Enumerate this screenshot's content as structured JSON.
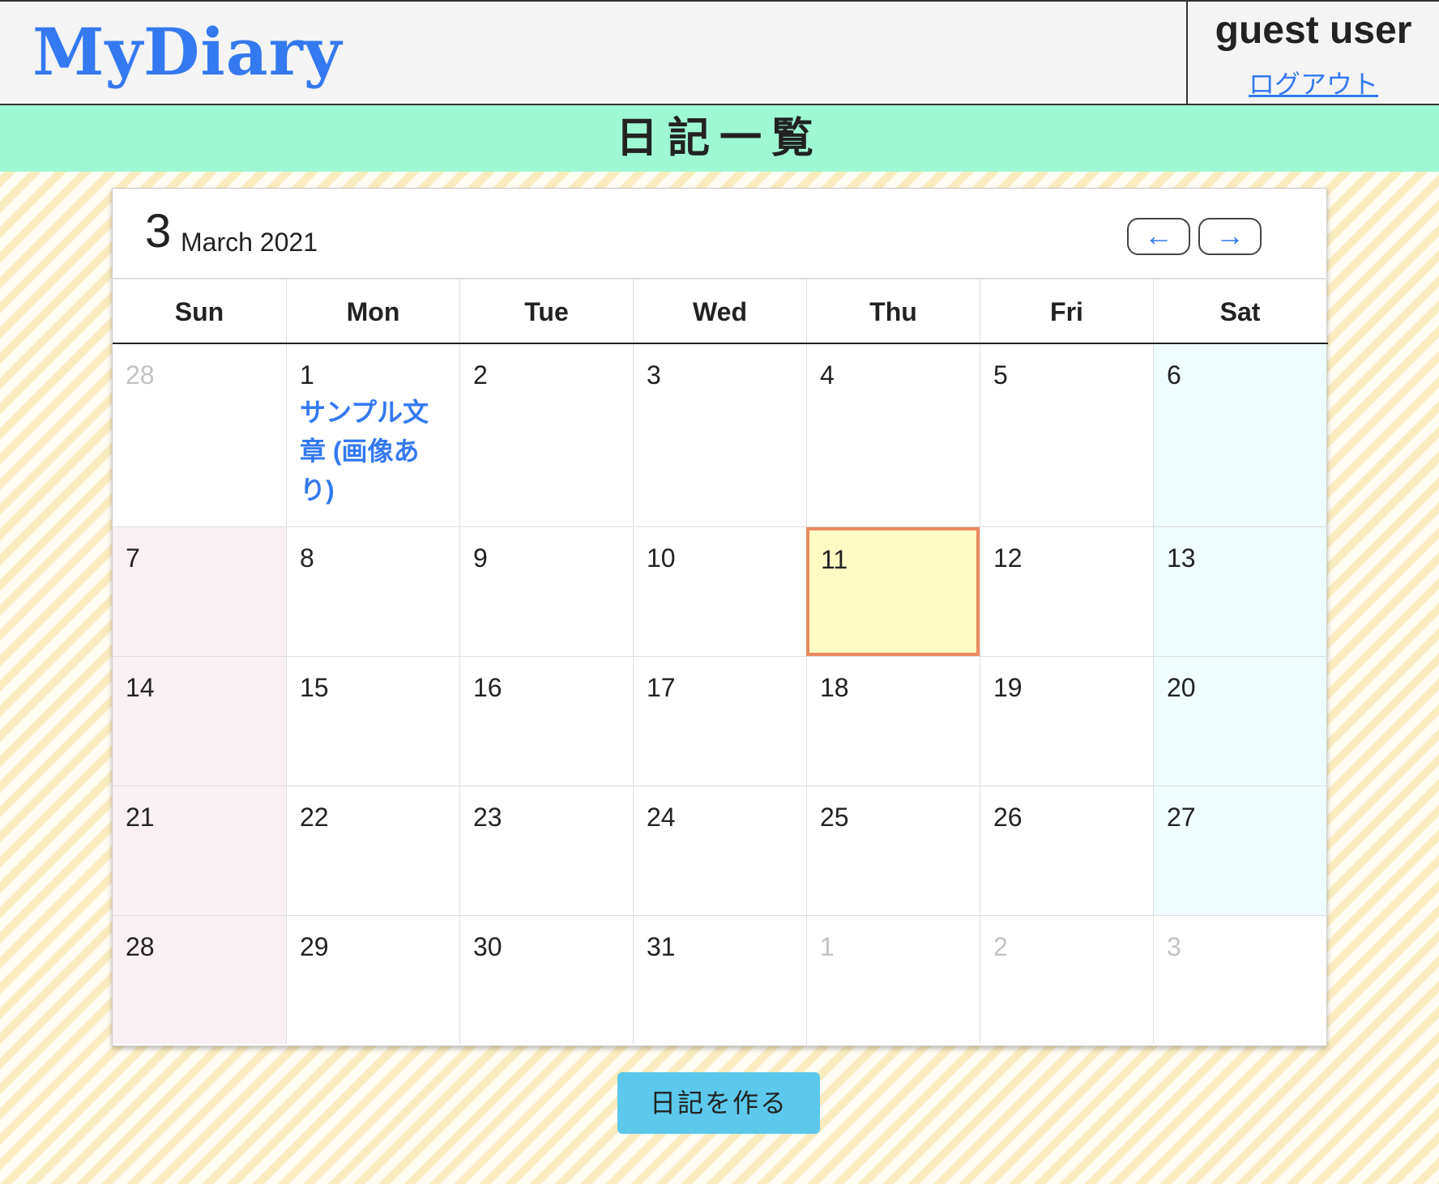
{
  "header": {
    "logo": "MyDiary",
    "user_name": "guest user",
    "logout_label": "ログアウト"
  },
  "banner": {
    "title": "日記一覧"
  },
  "calendar": {
    "month_number": "3",
    "month_label": "March 2021",
    "prev_icon": "←",
    "next_icon": "→",
    "weekdays": [
      "Sun",
      "Mon",
      "Tue",
      "Wed",
      "Thu",
      "Fri",
      "Sat"
    ],
    "today": "11",
    "entries": {
      "1": "サンプル文章 (画像あり)"
    },
    "weeks": [
      [
        "28",
        "1",
        "2",
        "3",
        "4",
        "5",
        "6"
      ],
      [
        "7",
        "8",
        "9",
        "10",
        "11",
        "12",
        "13"
      ],
      [
        "14",
        "15",
        "16",
        "17",
        "18",
        "19",
        "20"
      ],
      [
        "21",
        "22",
        "23",
        "24",
        "25",
        "26",
        "27"
      ],
      [
        "28",
        "29",
        "30",
        "31",
        "1",
        "2",
        "3"
      ]
    ]
  },
  "actions": {
    "create_label": "日記を作る"
  },
  "colors": {
    "accent": "#3479f0",
    "banner": "#9ef8d4",
    "today_bg": "#fefcc4",
    "today_border": "#ea8a60",
    "button": "#5bc8ec"
  }
}
